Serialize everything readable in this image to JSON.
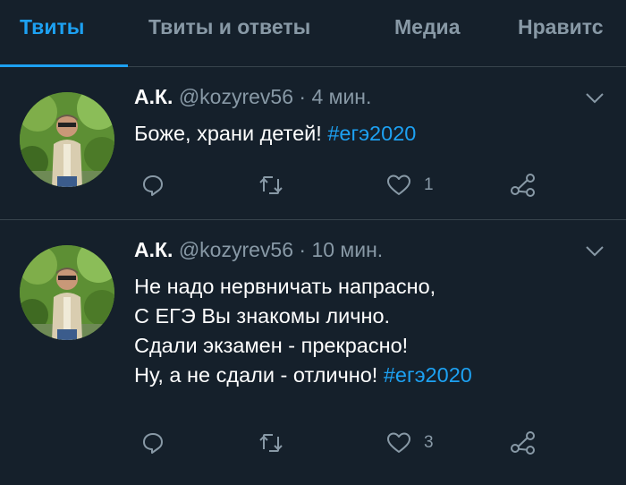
{
  "tabs": [
    {
      "label": "Твиты",
      "active": true
    },
    {
      "label": "Твиты и ответы",
      "active": false
    },
    {
      "label": "Медиа",
      "active": false
    },
    {
      "label": "Нравитс",
      "active": false
    }
  ],
  "tweets": [
    {
      "name": "А.К.",
      "handle": "@kozyrev56",
      "time": "· 4 мин.",
      "lines": [
        "Боже, храни детей!"
      ],
      "hashtag": "#егэ2020",
      "likes": "1"
    },
    {
      "name": "А.К.",
      "handle": "@kozyrev56",
      "time": "· 10 мин.",
      "lines": [
        "Не надо нервничать напрасно,",
        "С ЕГЭ Вы знакомы лично.",
        "Сдали экзамен - прекрасно!",
        "Ну, а не сдали - отлично!"
      ],
      "hashtag": "#егэ2020",
      "likes": "3"
    }
  ],
  "icons": [
    "reply-icon",
    "retweet-icon",
    "like-icon",
    "share-icon",
    "chevron-down-icon"
  ],
  "colors": {
    "background": "#15202b",
    "accent": "#1da1f2",
    "muted": "#8899a6",
    "divider": "#38444d"
  }
}
